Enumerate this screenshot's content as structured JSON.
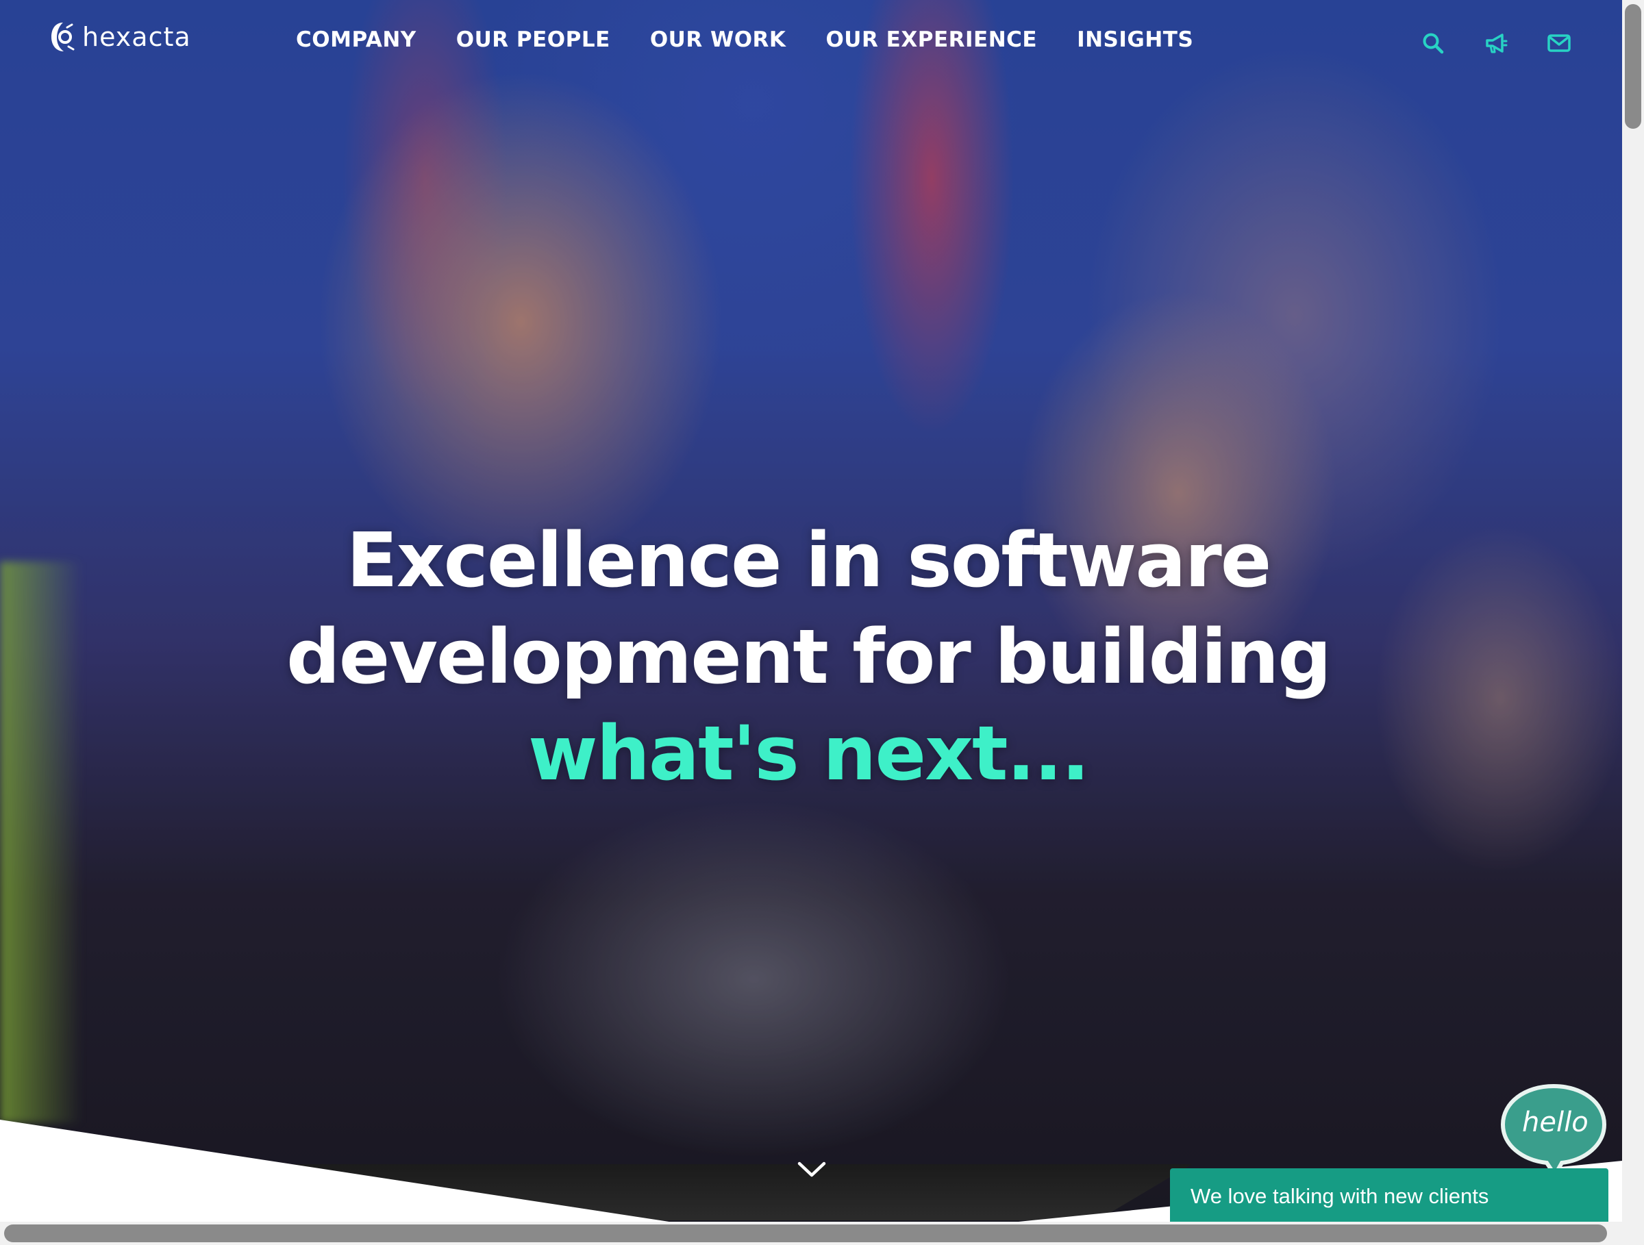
{
  "brand": {
    "name": "hexacta",
    "accent": "#3ef0c8",
    "chat_color": "#169c84"
  },
  "nav": {
    "items": [
      {
        "label": "COMPANY"
      },
      {
        "label": "OUR PEOPLE"
      },
      {
        "label": "OUR WORK"
      },
      {
        "label": "OUR EXPERIENCE"
      },
      {
        "label": "INSIGHTS"
      }
    ]
  },
  "tools": {
    "icons": [
      "search-icon",
      "megaphone-icon",
      "envelope-icon"
    ]
  },
  "hero": {
    "line1": "Excellence in software",
    "line2": "development for building",
    "line3": "what's next..."
  },
  "chat": {
    "bubble_text": "hello",
    "bar_text": "We love talking with new clients"
  }
}
